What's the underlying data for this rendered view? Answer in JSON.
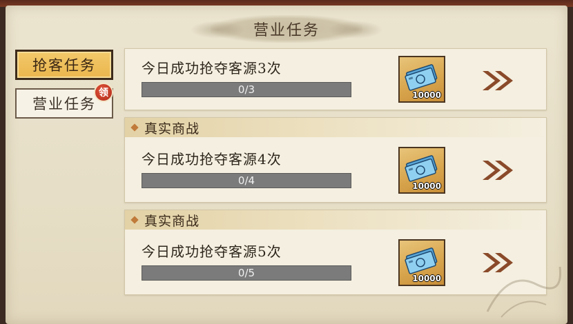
{
  "header": {
    "title": "营业任务"
  },
  "tabs": [
    {
      "label": "抢客任务",
      "active": true
    },
    {
      "label": "营业任务",
      "active": false,
      "badge": "领"
    }
  ],
  "tasks": [
    {
      "section": "",
      "text": "今日成功抢夺客源3次",
      "progress_text": "0/3",
      "progress": 0,
      "reward_qty": "10000",
      "reward_icon": "banknote-icon"
    },
    {
      "section": "真实商战",
      "text": "今日成功抢夺客源4次",
      "progress_text": "0/4",
      "progress": 0,
      "reward_qty": "10000",
      "reward_icon": "banknote-icon"
    },
    {
      "section": "真实商战",
      "text": "今日成功抢夺客源5次",
      "progress_text": "0/5",
      "progress": 0,
      "reward_qty": "10000",
      "reward_icon": "banknote-icon"
    }
  ],
  "colors": {
    "accent": "#eab64e",
    "panel": "#e6dec6",
    "bar": "#7b7b7b",
    "badge": "#c23a22"
  }
}
